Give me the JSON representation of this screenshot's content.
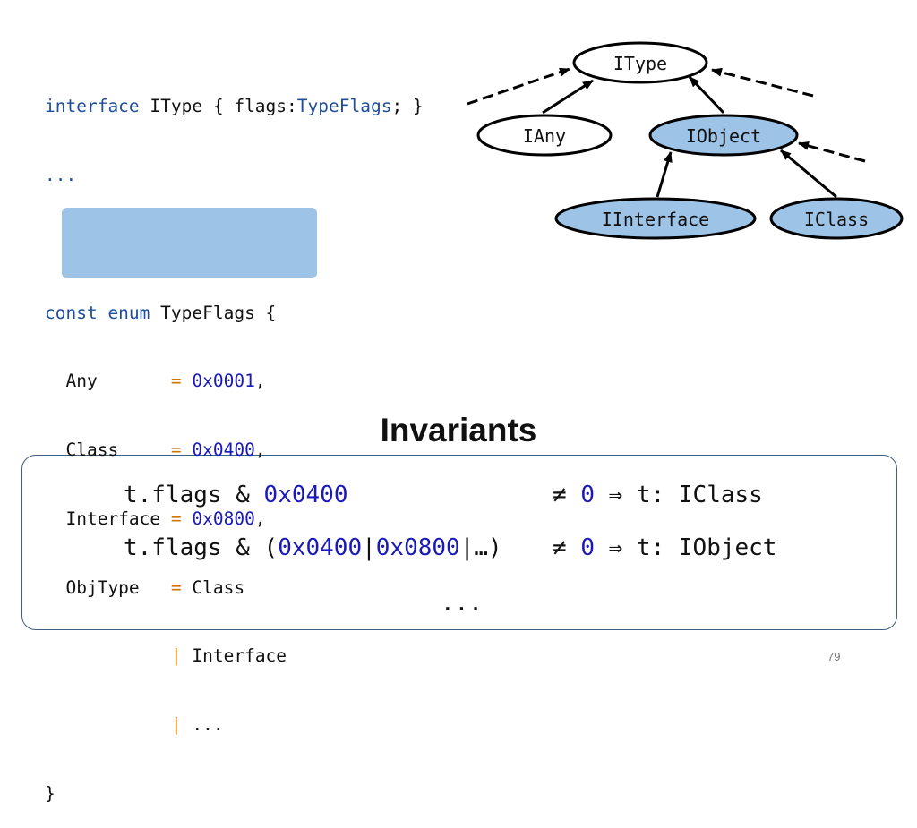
{
  "code": {
    "line1": {
      "kw": "interface",
      "name": " IType { flags:",
      "type": "TypeFlags",
      "rest": "; }"
    },
    "line2": "...",
    "line4": {
      "kw1": "const",
      "kw2": " enum",
      "rest": " TypeFlags {"
    },
    "members": [
      {
        "name": "  Any       ",
        "op": "=",
        "value": " 0x0001",
        "tail": ","
      },
      {
        "name": "  Class     ",
        "op": "=",
        "value": " 0x0400",
        "tail": ","
      },
      {
        "name": "  Interface ",
        "op": "=",
        "value": " 0x0800",
        "tail": ","
      }
    ],
    "objtype": [
      {
        "name": "  ObjType   ",
        "op": "=",
        "value": " Class"
      },
      {
        "name": "            ",
        "op": "|",
        "value": " Interface"
      },
      {
        "name": "            ",
        "op": "|",
        "value": " ..."
      }
    ],
    "close": "}"
  },
  "tree": {
    "nodes": {
      "itype": "IType",
      "iany": "IAny",
      "iobject": "IObject",
      "iinterface": "IInterface",
      "iclass": "IClass"
    },
    "colors": {
      "plain_fill": "#ffffff",
      "highlight_fill": "#9dc3e6",
      "stroke": "#000000"
    }
  },
  "invariants": {
    "title": "Invariants",
    "row1": {
      "lhs": "t.flags & ",
      "mask": "0x0400",
      "neq": "≠ ",
      "zero": "0",
      "rhs": " ⇒ t: IClass"
    },
    "row2": {
      "lhs": "t.flags & (",
      "m1": "0x0400",
      "sep1": "|",
      "m2": "0x0800",
      "sep2": "|…) ",
      "neq": "≠ ",
      "zero": "0",
      "rhs": " ⇒ t: IObject"
    },
    "row3": "..."
  },
  "page_number": "79"
}
